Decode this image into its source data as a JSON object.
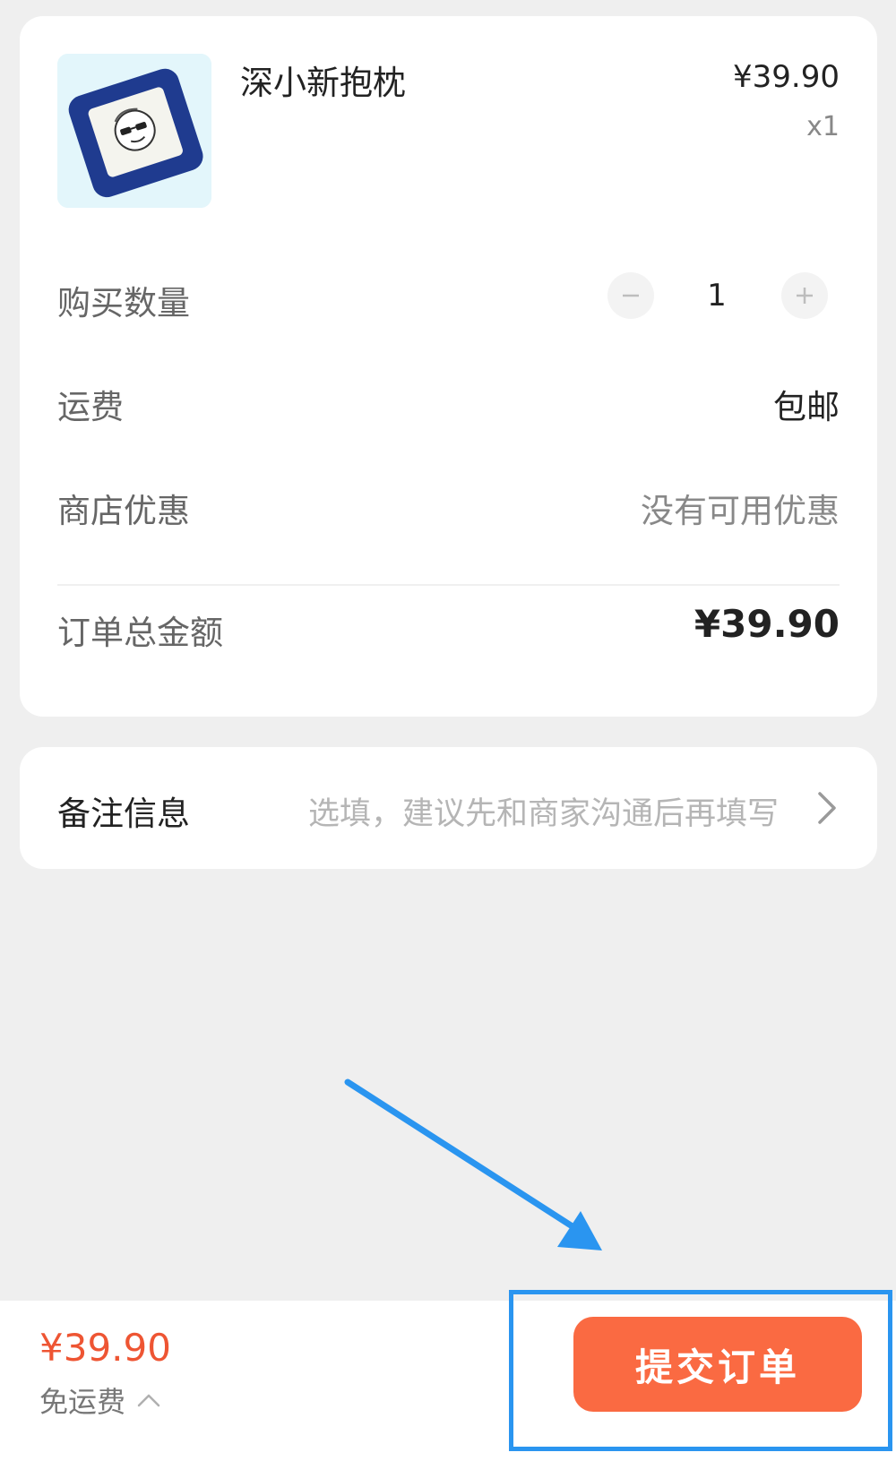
{
  "product": {
    "name": "深小新抱枕",
    "price": "¥39.90",
    "quantity_label": "x1",
    "image_icon": "pillow-image"
  },
  "rows": {
    "quantity": {
      "label": "购买数量",
      "value": "1"
    },
    "shipping": {
      "label": "运费",
      "value": "包邮"
    },
    "discount": {
      "label": "商店优惠",
      "value": "没有可用优惠"
    },
    "total": {
      "label": "订单总金额",
      "value": "¥39.90"
    }
  },
  "remark": {
    "label": "备注信息",
    "placeholder": "选填，建议先和商家沟通后再填写"
  },
  "footer": {
    "price": "¥39.90",
    "shipping_note": "免运费",
    "submit_label": "提交订单"
  },
  "colors": {
    "accent": "#fa6a42",
    "price_red": "#ee5533",
    "annotation_blue": "#2a95f0"
  }
}
